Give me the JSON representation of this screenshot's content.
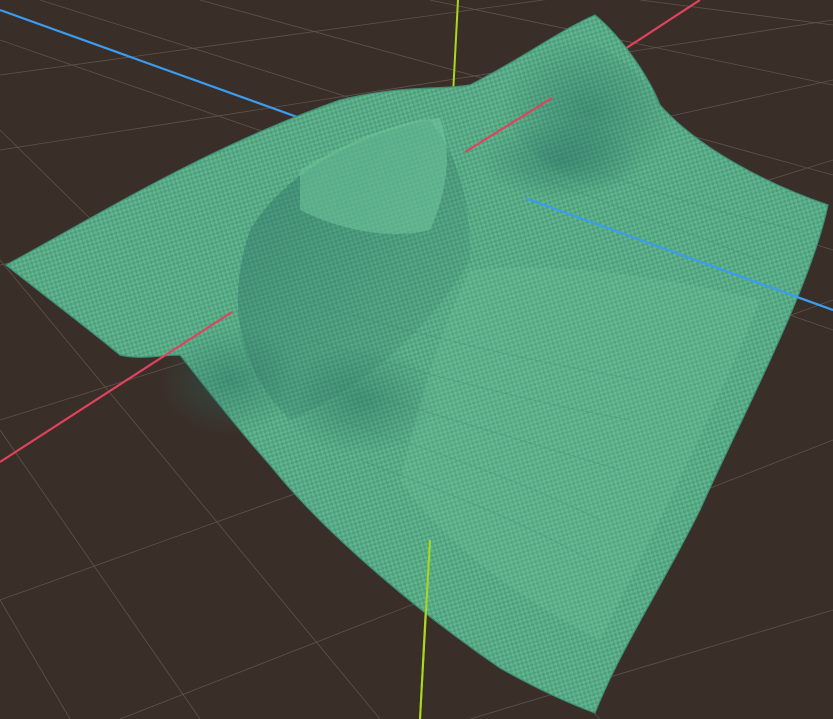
{
  "viewport": {
    "kind": "3d-editor-viewport",
    "background_color": "#3a2f28",
    "grid_color": "#7d7068",
    "axes": {
      "x_color": "#e0435e",
      "y_color": "#a9d81e",
      "z_color": "#3b9cf0"
    },
    "mesh": {
      "name": "terrain",
      "base_color": "#58b489",
      "shade_color": "#2f7f6f",
      "highlight_color": "#7fcfa6",
      "texture": "checker"
    }
  }
}
